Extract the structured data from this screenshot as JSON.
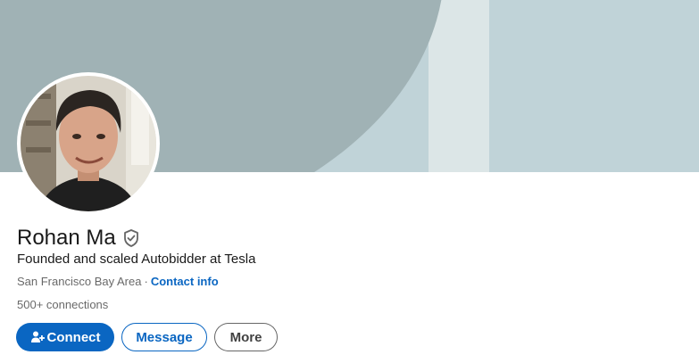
{
  "profile": {
    "name": "Rohan Ma",
    "headline": "Founded and scaled Autobidder at Tesla",
    "location": "San Francisco Bay Area",
    "separator": "·",
    "contact_info_label": "Contact info",
    "connections": "500+ connections"
  },
  "actions": {
    "connect_label": "Connect",
    "message_label": "Message",
    "more_label": "More"
  },
  "icons": {
    "verified": "verified-shield-icon",
    "connect": "add-person-icon"
  },
  "colors": {
    "accent": "#0a66c2",
    "banner_light": "#c0d3d8",
    "banner_dark": "#a0b2b5"
  }
}
